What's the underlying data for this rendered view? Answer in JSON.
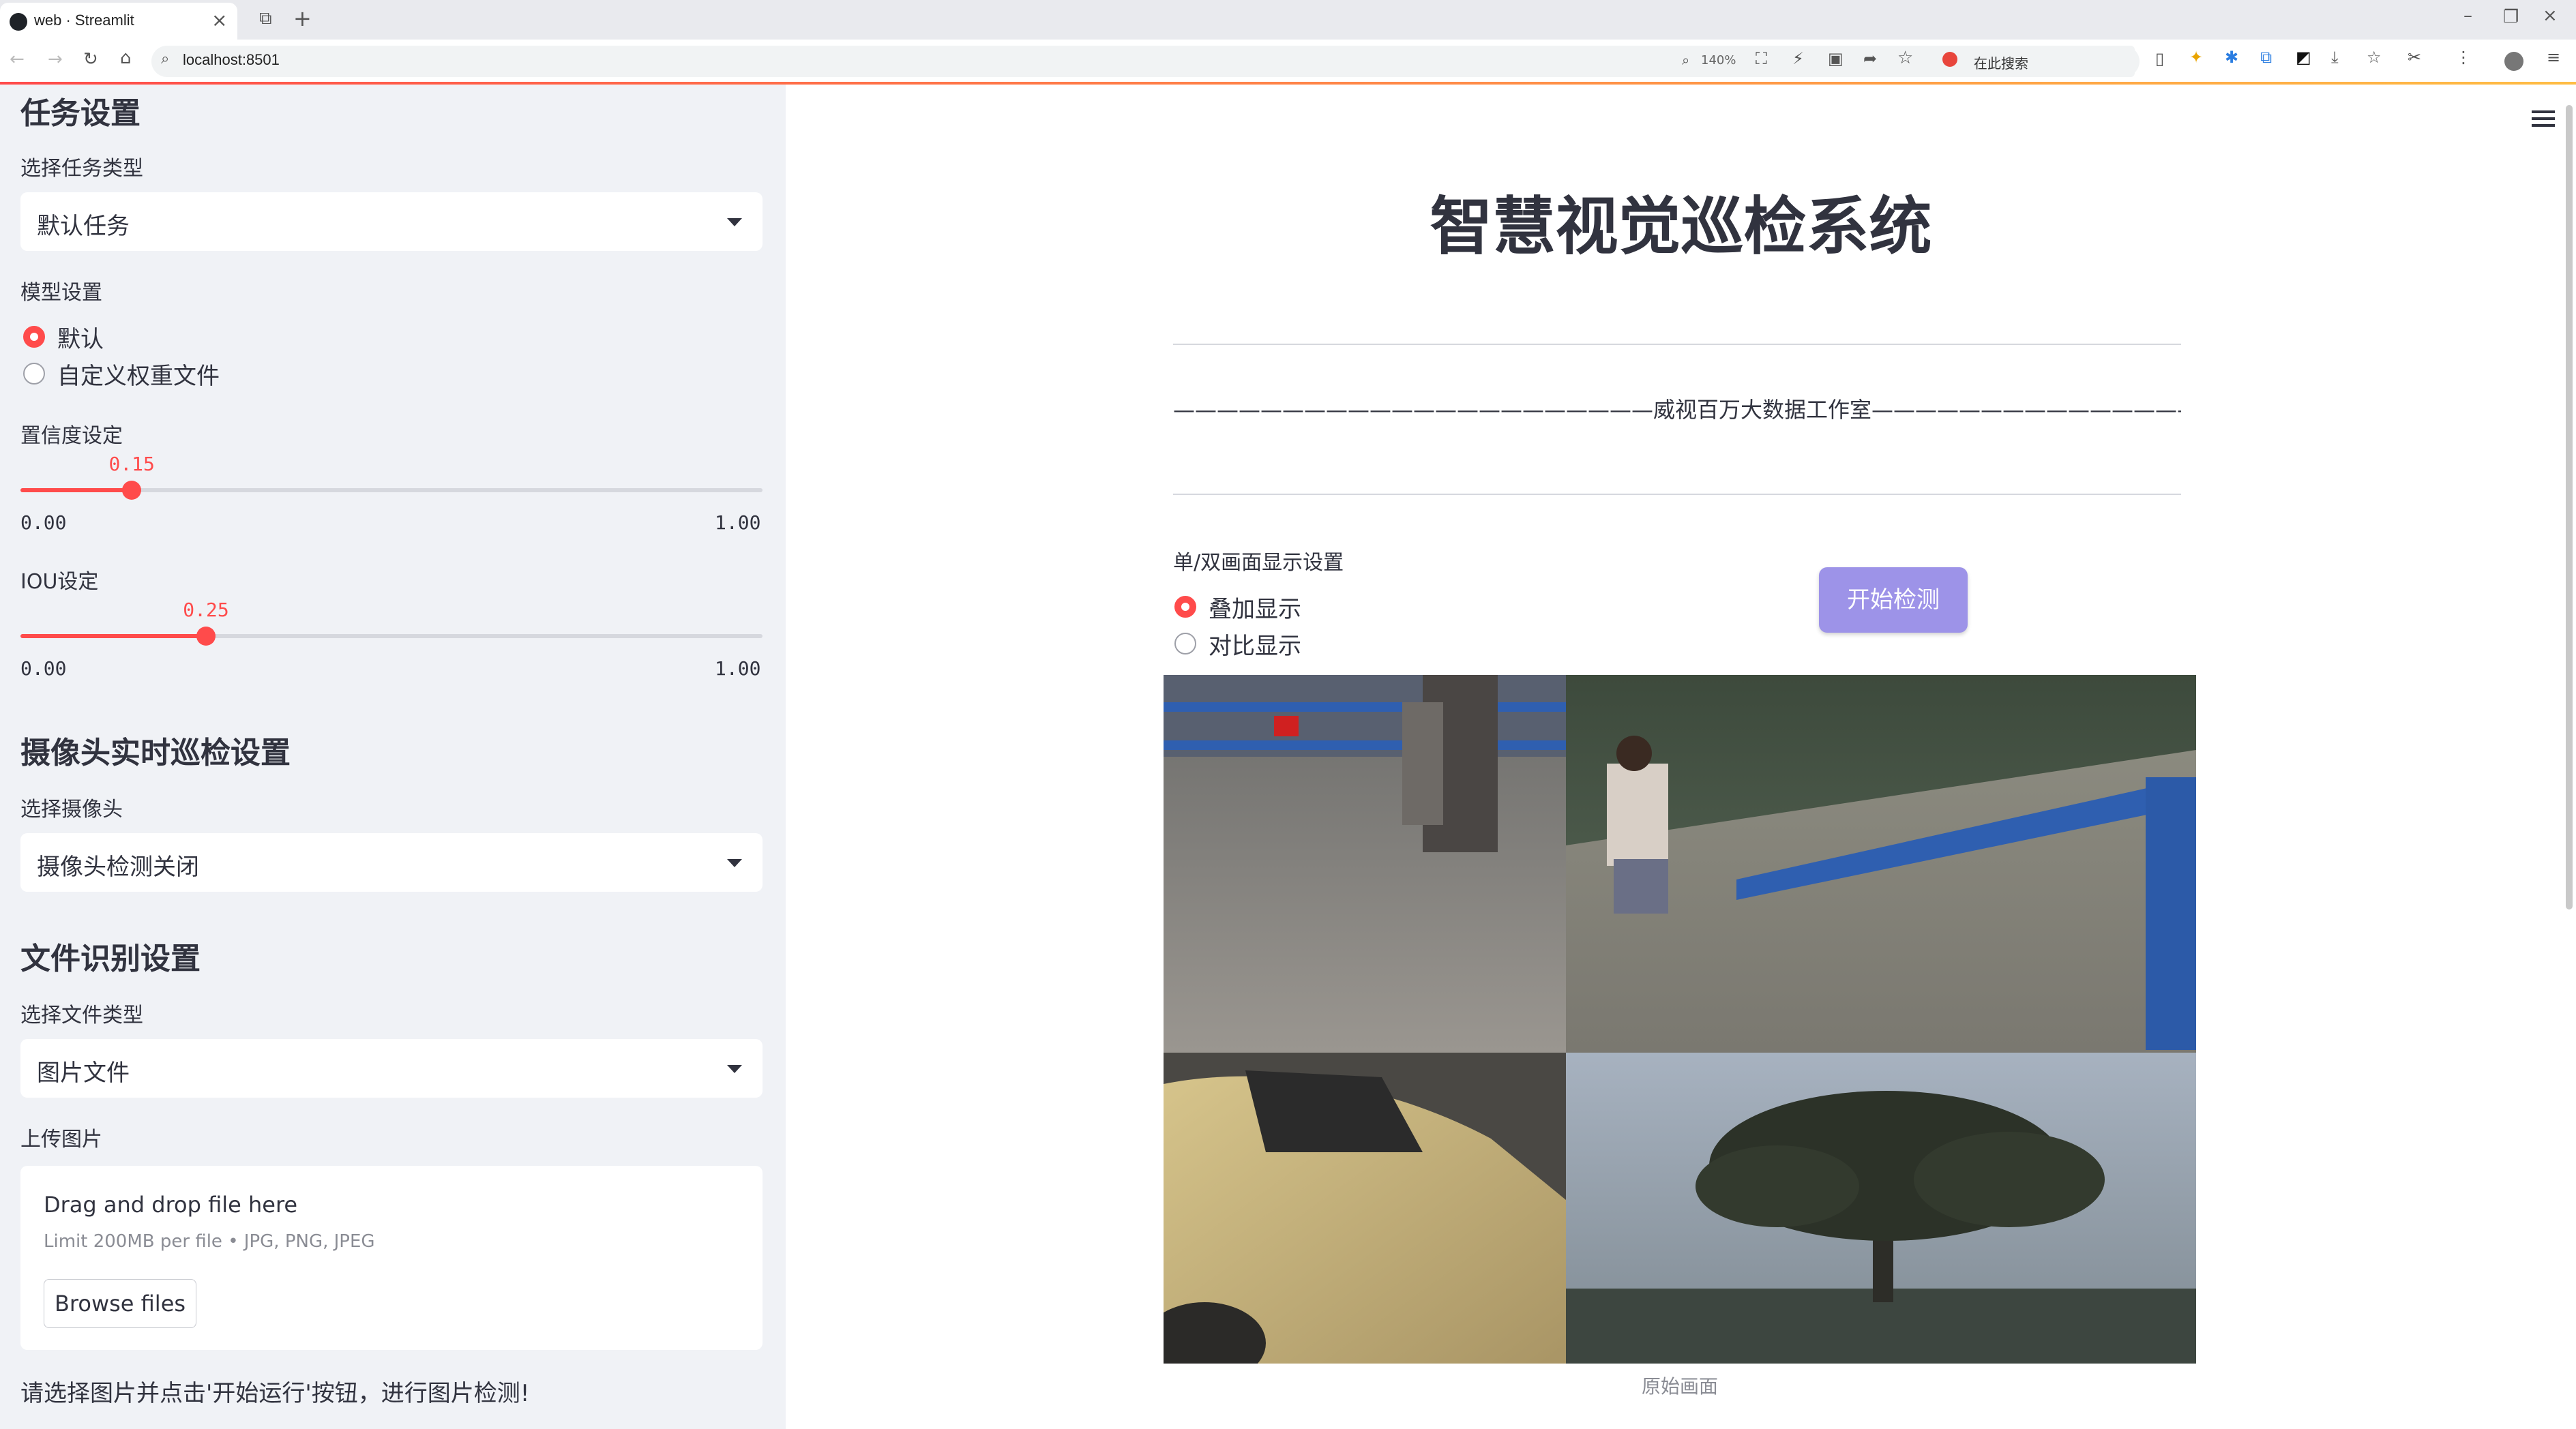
{
  "browser": {
    "tab_title": "web · Streamlit",
    "url": "localhost:8501",
    "zoom": "140%",
    "search_placeholder": "在此搜索"
  },
  "sidebar": {
    "task_header": "任务设置",
    "task_type_label": "选择任务类型",
    "task_type_value": "默认任务",
    "model_label": "模型设置",
    "model_options": [
      "默认",
      "自定义权重文件"
    ],
    "model_selected": 0,
    "conf_label": "置信度设定",
    "conf_value": "0.15",
    "conf_fraction": 0.15,
    "conf_min": "0.00",
    "conf_max": "1.00",
    "iou_label": "IOU设定",
    "iou_value": "0.25",
    "iou_fraction": 0.25,
    "iou_min": "0.00",
    "iou_max": "1.00",
    "camera_header": "摄像头实时巡检设置",
    "camera_label": "选择摄像头",
    "camera_value": "摄像头检测关闭",
    "file_header": "文件识别设置",
    "file_type_label": "选择文件类型",
    "file_type_value": "图片文件",
    "upload_label": "上传图片",
    "upload_drop": "Drag and drop file here",
    "upload_limit": "Limit 200MB per file • JPG, PNG, JPEG",
    "browse_label": "Browse files",
    "hint": "请选择图片并点击'开始运行'按钮，进行图片检测!"
  },
  "main": {
    "title": "智慧视觉巡检系统",
    "subtitle": "——————————————————————威视百万大数据工作室———————————————————————",
    "display_label": "单/双画面显示设置",
    "display_options": [
      "叠加显示",
      "对比显示"
    ],
    "display_selected": 0,
    "start_button": "开始检测",
    "image_caption": "原始画面"
  }
}
